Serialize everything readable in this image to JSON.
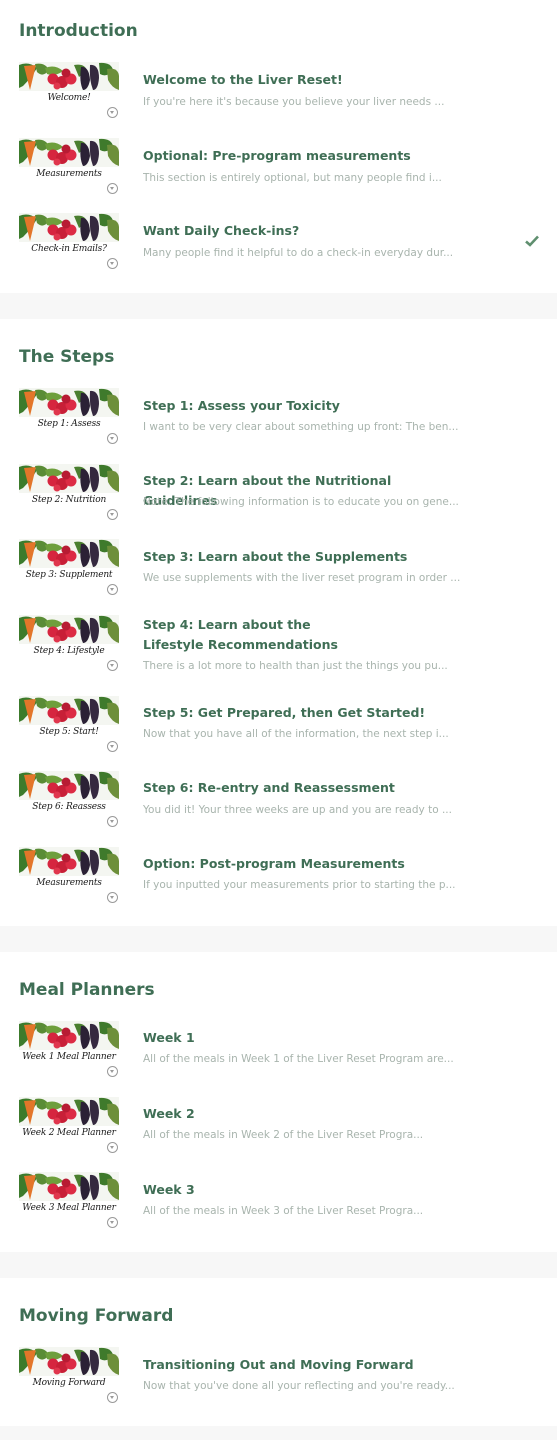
{
  "sections": [
    {
      "title": "Introduction",
      "lessons": [
        {
          "thumb_caption": "Welcome!",
          "title": "Welcome to the Liver Reset!",
          "description": "If you're here it's because you believe your liver needs ...",
          "completed": false
        },
        {
          "thumb_caption": "Measurements",
          "title": "Optional: Pre-program measurements",
          "description": "This section is entirely optional, but many people find i...",
          "completed": false
        },
        {
          "thumb_caption": "Check-in Emails?",
          "title": "Want Daily Check-ins?",
          "description": "Many people find it helpful to do a check-in everyday dur...",
          "completed": true
        }
      ]
    },
    {
      "title": "The Steps",
      "lessons": [
        {
          "thumb_caption": "Step 1: Assess",
          "title": "Step 1: Assess your Toxicity",
          "description": "I want to be very clear about something up front: The ben...",
          "completed": false
        },
        {
          "thumb_caption": "Step 2: Nutrition",
          "title": "Step 2: Learn about the Nutritional Guidelines",
          "description": "Note: The following information is to educate you on gene...",
          "completed": false
        },
        {
          "thumb_caption": "Step 3: Supplement",
          "title": "Step 3: Learn about the Supplements",
          "description": "We use supplements with the liver reset program in order ...",
          "completed": false
        },
        {
          "thumb_caption": "Step 4: Lifestyle",
          "title": "Step 4: Learn about the Lifestyle Recommendations",
          "description": "There is a lot more to health than just the things you pu...",
          "completed": false
        },
        {
          "thumb_caption": "Step 5: Start!",
          "title": "Step 5: Get Prepared, then Get Started!",
          "description": "Now that you have all of the information, the next step i...",
          "completed": false
        },
        {
          "thumb_caption": "Step 6: Reassess",
          "title": "Step 6: Re-entry and Reassessment",
          "description": "You did it! Your three weeks are up and you are ready to ...",
          "completed": false
        },
        {
          "thumb_caption": "Measurements",
          "title": "Option: Post-program Measurements",
          "description": "If you inputted your measurements prior to starting the p...",
          "completed": false
        }
      ]
    },
    {
      "title": "Meal Planners",
      "lessons": [
        {
          "thumb_caption": "Week 1 Meal Planner",
          "title": "Week 1",
          "description": "All of the meals in Week 1 of the Liver Reset Program are...",
          "completed": false
        },
        {
          "thumb_caption": "Week 2 Meal Planner",
          "title": "Week 2",
          "description": "All of the meals in Week 2 of the Liver Reset Progra...",
          "completed": false
        },
        {
          "thumb_caption": "Week 3 Meal Planner",
          "title": "Week 3",
          "description": "All of the meals in Week 3 of the Liver Reset Progra...",
          "completed": false
        }
      ]
    },
    {
      "title": "Moving Forward",
      "lessons": [
        {
          "thumb_caption": "Moving Forward",
          "title": "Transitioning Out and Moving Forward",
          "description": "Now that you've done all your reflecting and you're ready...",
          "completed": false
        }
      ]
    }
  ],
  "colors": {
    "accent": "#3f6e55",
    "description": "#a8b4ad",
    "check": "#5f8f6f"
  },
  "icons": {
    "completed": "check-icon",
    "video": "play-icon"
  }
}
